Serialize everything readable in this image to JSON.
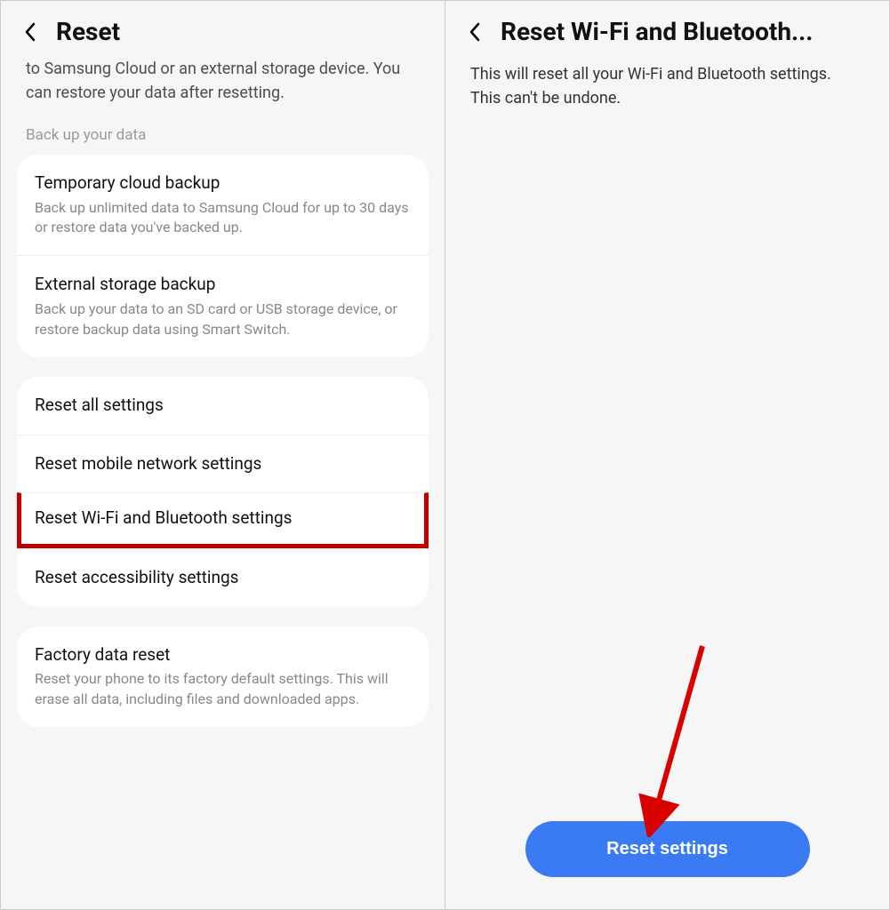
{
  "left": {
    "title": "Reset",
    "intro": "to Samsung Cloud or an external storage device. You can restore your data after resetting.",
    "sectionLabel": "Back up your data",
    "backupGroup": [
      {
        "title": "Temporary cloud backup",
        "desc": "Back up unlimited data to Samsung Cloud for up to 30 days or restore data you've backed up."
      },
      {
        "title": "External storage backup",
        "desc": "Back up your data to an SD card or USB storage device, or restore backup data using Smart Switch."
      }
    ],
    "resetGroup": [
      {
        "title": "Reset all settings"
      },
      {
        "title": "Reset mobile network settings"
      },
      {
        "title": "Reset Wi-Fi and Bluetooth settings",
        "highlighted": true
      },
      {
        "title": "Reset accessibility settings"
      }
    ],
    "factoryGroup": [
      {
        "title": "Factory data reset",
        "desc": "Reset your phone to its factory default settings. This will erase all data, including files and downloaded apps."
      }
    ]
  },
  "right": {
    "title": "Reset Wi-Fi and Bluetooth...",
    "intro": "This will reset all your Wi-Fi and Bluetooth settings. This can't be undone.",
    "buttonLabel": "Reset settings"
  }
}
